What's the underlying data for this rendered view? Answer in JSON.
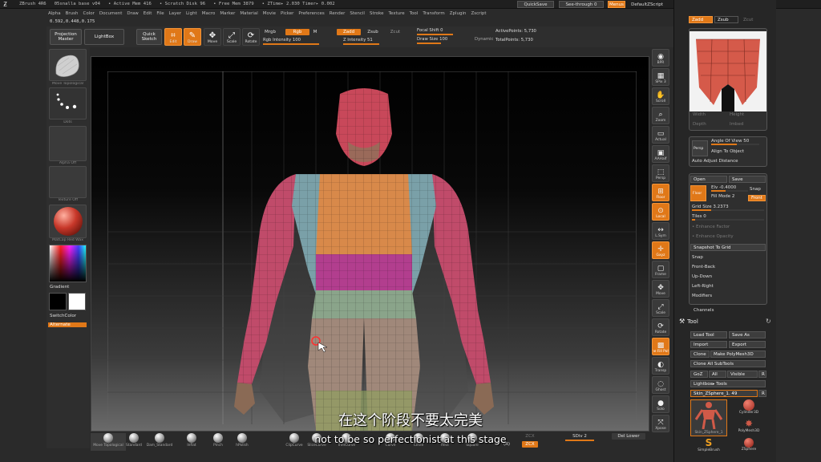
{
  "titlebar": {
    "app": "ZBrush 4R6",
    "file": "05snalla base v04",
    "active_mem": "• Active Mem 416",
    "scratch_disk": "• Scratch Disk 96",
    "free_mem": "• Free Mem 3879",
    "ztime": "• ZTime▸ 2.030 Timer▸ 0.002",
    "quicksave": "QuickSave",
    "see_through": "See-through  0",
    "menus": "Menus",
    "script": "DefaultZScript"
  },
  "menubar": [
    "Alpha",
    "Brush",
    "Color",
    "Document",
    "Draw",
    "Edit",
    "File",
    "Layer",
    "Light",
    "Macro",
    "Marker",
    "Material",
    "Movie",
    "Picker",
    "Preferences",
    "Render",
    "Stencil",
    "Stroke",
    "Texture",
    "Tool",
    "Transform",
    "Zplugin",
    "Zscript"
  ],
  "coords": "0.592,0.448,0.175",
  "shelf": {
    "projection_master": "Projection Master",
    "lightbox": "LightBox",
    "quick_sketch": "Quick Sketch",
    "edit": "Edit",
    "draw": "Draw",
    "move": "Move",
    "scale": "Scale",
    "rotate": "Rotate",
    "mrgb": "Mrgb",
    "rgb": "Rgb",
    "m": "M",
    "zadd": "Zadd",
    "zsub": "Zsub",
    "zcut": "Zcut",
    "rgb_intensity": "Rgb Intensity 100",
    "z_intensity": "Z Intensity 51",
    "focal_shift": "Focal Shift 0",
    "draw_size": "Draw Size 100",
    "dynamic": "Dynamic",
    "active_points": "ActivePoints: 5,730",
    "total_points": "TotalPoints: 5,730"
  },
  "left": {
    "brush_caption": "Move  Topological",
    "stroke_caption": "Dots",
    "alpha_caption": "Alpha  Off",
    "texture_caption": "Texture  Off",
    "material_caption": "MatCap  Red  Wax",
    "gradient": "Gradient",
    "switchcolor": "SwitchColor",
    "alternate": "Alternate"
  },
  "right_shelf": [
    "BPR",
    "SPix 3",
    "Scroll",
    "Zoom",
    "Actual",
    "AAHalf",
    "Persp",
    "Floor",
    "Local",
    "L.Sym",
    "Gxyz",
    "Frame",
    "Move",
    "Scale",
    "Rotate",
    "Line Fill PolyF",
    "Transp",
    "Ghost",
    "Solo",
    "Xpose"
  ],
  "palette": {
    "zadd": "Zadd",
    "zsub": "Zsub",
    "zcut": "Zcut",
    "width": "Width",
    "height": "Height",
    "depth": "Depth",
    "imbed": "Imbed",
    "persp": "Persp",
    "angle_of_view": "Angle Of View 50",
    "align_to_object": "Align To Object",
    "auto_adjust": "Auto Adjust Distance",
    "open": "Open",
    "save": "Save",
    "floor": "Floor",
    "elv": "Elv -0.4000",
    "snap": "Snap",
    "fill_mode": "Fill Mode 2",
    "front": "Front",
    "grid_size": "Grid Size 3.2373",
    "tiles": "Tiles 0",
    "enhance_factor": "• Enhance Factor",
    "enhance_opacity": "• Enhance Opacity",
    "snapshot": "Snapshot To Grid",
    "snap2": "Snap",
    "front_back": "Front-Back",
    "up_down": "Up-Down",
    "left_right": "Left-Right",
    "modifiers": "Modifiers",
    "channels": "Channels",
    "tool_title": "Tool",
    "load_tool": "Load Tool",
    "save_as": "Save As",
    "import": "Import",
    "export": "Export",
    "clone": "Clone",
    "make_polymesh": "Make PolyMesh3D",
    "clone_all": "Clone All SubTools",
    "goz": "GoZ",
    "all": "All",
    "visible": "Visible",
    "r": "R",
    "lightbox_tools": "Lightbox▸ Tools",
    "current_tool": "Skin_ZSphere_1. 49",
    "r2": "R",
    "thumb_skin": "Skin_ZSphere_1",
    "thumb_cyl": "Cylinder3D",
    "thumb_poly": "PolyMesh3D",
    "thumb_simple": "SimpleBrush",
    "thumb_zsphere": "ZSphere"
  },
  "bottom": {
    "brushes": [
      "Move Topological",
      "Standard",
      "Dam_Standard",
      "Inflat",
      "Pinch",
      "hPolish",
      "ClipCurve",
      "SliceCurve",
      "TrimCurve",
      "Curve",
      "Circle",
      "Rect",
      "Square"
    ],
    "sdiv": "SDiv 2",
    "del_lower": "Del Lower",
    "r": "(R)",
    "zcut_small": "ZCX",
    "zcut_small2": "ZCX"
  },
  "subtitles": {
    "zh": "在这个阶段不要太完美",
    "en": "not to be so perfectionist at this stage"
  },
  "colors": {
    "accent": "#e07818",
    "panel": "#262626"
  }
}
